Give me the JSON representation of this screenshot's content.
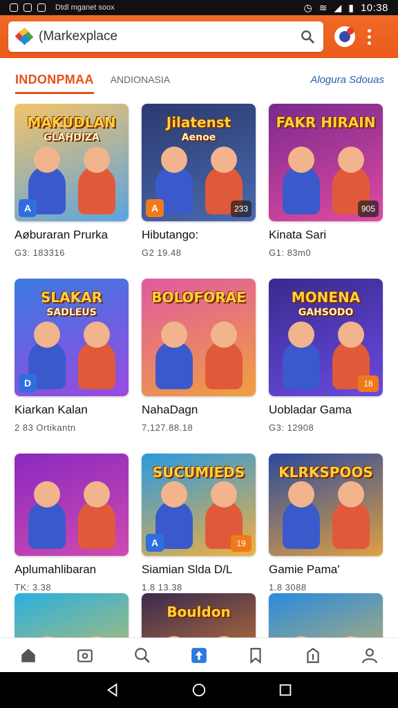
{
  "status_bar": {
    "notification_text": "Dtdl mganet soox",
    "time": "10:38"
  },
  "search": {
    "value": "(Markexplace"
  },
  "tabs": {
    "active": "INDONPMAA",
    "secondary": "ANDIONASIA",
    "link": "Alogura Sdouas"
  },
  "cards": [
    {
      "title": "Aøburaran Prurka",
      "meta": "G3: 183316",
      "art_title": "MAKUDLAN",
      "art_sub": "GLAHDIZA",
      "corner": "",
      "badge": "A",
      "colors": [
        "#f4c36a",
        "#5aa3e0"
      ]
    },
    {
      "title": "Hibutango:",
      "meta": "G2 19.48",
      "art_title": "Jilatenst",
      "art_sub": "Aenoe",
      "corner": "233",
      "badge": "A",
      "colors": [
        "#2a3a6e",
        "#4a6ab0"
      ]
    },
    {
      "title": "Kinata Sari",
      "meta": "G1: 83m0",
      "art_title": "FAKR HIRAIN",
      "art_sub": "",
      "corner": "905",
      "badge": "",
      "colors": [
        "#7a2a8e",
        "#e04aa0"
      ]
    },
    {
      "title": "Kiarkan Kalan",
      "meta": "2 83 Ortikantn",
      "art_title": "SLAKAR",
      "art_sub": "SADLEUS",
      "corner": "",
      "badge": "D",
      "colors": [
        "#3a7ae0",
        "#9a4ae0"
      ]
    },
    {
      "title": "NahaDagn",
      "meta": "7,127.88.18",
      "art_title": "BOLOFORAE",
      "art_sub": "",
      "corner": "",
      "badge": "",
      "colors": [
        "#e05aa0",
        "#f0a040"
      ]
    },
    {
      "title": "Uobladar Gama",
      "meta": "G3: 12908",
      "art_title": "MONENA",
      "art_sub": "GAHSODO",
      "corner": "18",
      "badge": "",
      "colors": [
        "#3a2a8e",
        "#6a4ae0"
      ]
    },
    {
      "title": "Aplumahlibaran",
      "meta": "TK: 3.38",
      "art_title": "",
      "art_sub": "",
      "corner": "",
      "badge": "",
      "colors": [
        "#8a2ac0",
        "#d04ab0"
      ]
    },
    {
      "title": "Siamian Slda D/L",
      "meta": "1.8 13.38",
      "art_title": "SUCUMIEDS",
      "art_sub": "",
      "corner": "19",
      "badge": "A",
      "colors": [
        "#2a9ae0",
        "#f0b040"
      ]
    },
    {
      "title": "Gamie Pama'",
      "meta": "1.8 3088",
      "art_title": "KLRKSPOOS",
      "art_sub": "",
      "corner": "",
      "badge": "",
      "colors": [
        "#2a4a9e",
        "#e0a040"
      ]
    },
    {
      "title": "",
      "meta": "",
      "art_title": "",
      "art_sub": "",
      "corner": "",
      "badge": "",
      "colors": [
        "#2ab0e0",
        "#f0c040"
      ]
    },
    {
      "title": "",
      "meta": "",
      "art_title": "Bouldon",
      "art_sub": "",
      "corner": "",
      "badge": "",
      "colors": [
        "#3a2a4e",
        "#f09030"
      ]
    },
    {
      "title": "",
      "meta": "",
      "art_title": "",
      "art_sub": "",
      "corner": "",
      "badge": "",
      "colors": [
        "#2a8ae0",
        "#f0c040"
      ]
    }
  ],
  "bottom_nav": [
    "home-icon",
    "wallet-icon",
    "search-icon",
    "upload-icon",
    "bookmark-icon",
    "info-icon",
    "profile-icon"
  ],
  "accent_color": "#e8501c",
  "link_color": "#2a5db0"
}
